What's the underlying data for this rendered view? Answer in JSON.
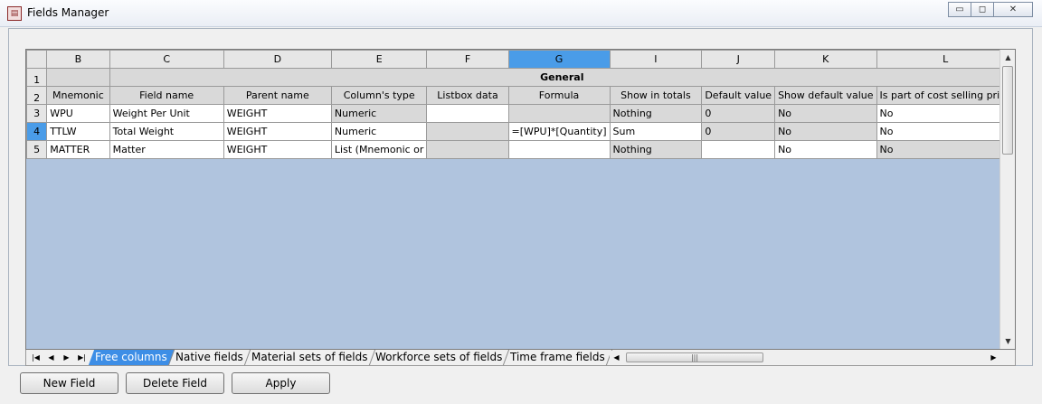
{
  "window": {
    "title": "Fields Manager",
    "app_icon_glyph": "▤",
    "minimize_glyph": "▭",
    "maximize_glyph": "◻",
    "close_glyph": "✕"
  },
  "grid": {
    "columns": [
      "B",
      "C",
      "D",
      "E",
      "F",
      "G",
      "I",
      "J",
      "K",
      "L"
    ],
    "selected_column": "G",
    "group_header": "General",
    "row_numbers": [
      "1",
      "2",
      "3",
      "4",
      "5"
    ],
    "selected_row": "4",
    "headers": [
      "Mnemonic",
      "Field name",
      "Parent name",
      "Column's type",
      "Listbox data",
      "Formula",
      "Show in totals",
      "Default value",
      "Show default value",
      "Is part of cost selling price"
    ],
    "rows": [
      [
        "WPU",
        "Weight Per Unit",
        "WEIGHT",
        "Numeric",
        "",
        "",
        "Nothing",
        "0",
        "No",
        "No"
      ],
      [
        "TTLW",
        "Total Weight",
        "WEIGHT",
        "Numeric",
        "",
        "=[WPU]*[Quantity]",
        "Sum",
        "0",
        "No",
        "No"
      ],
      [
        "MATTER",
        "Matter",
        "WEIGHT",
        "List (Mnemonic or",
        "",
        "",
        "Nothing",
        "",
        "No",
        "No"
      ]
    ],
    "scroll_up_glyph": "▲",
    "scroll_down_glyph": "▼",
    "scroll_left_glyph": "◀",
    "scroll_right_glyph": "▶",
    "thumb_grip": "|||"
  },
  "sheet_nav": {
    "first": "|◀",
    "prev": "◀",
    "next": "▶",
    "last": "▶|"
  },
  "tabs": [
    "Free columns",
    "Native fields",
    "Material sets of fields",
    "Workforce sets of fields",
    "Time frame fields"
  ],
  "active_tab": "Free columns",
  "buttons": {
    "new_field": "New Field",
    "delete_field": "Delete Field",
    "apply": "Apply"
  }
}
